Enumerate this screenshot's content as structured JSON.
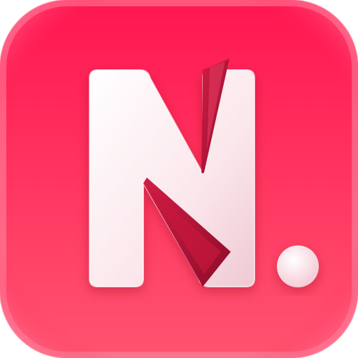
{
  "icon": {
    "name": "n-logo-app-icon",
    "glyph": "N",
    "has_dot": true
  },
  "colors": {
    "background_top": "#ff1e55",
    "background_bottom": "#ff4d6e",
    "bevel": "#ff8aa3",
    "letter_light": "#fff5f7",
    "letter_mid": "#f3d7de",
    "fold_dark": "#a3102f",
    "fold_mid": "#cc1c42",
    "dot": "#ffe9ee"
  }
}
